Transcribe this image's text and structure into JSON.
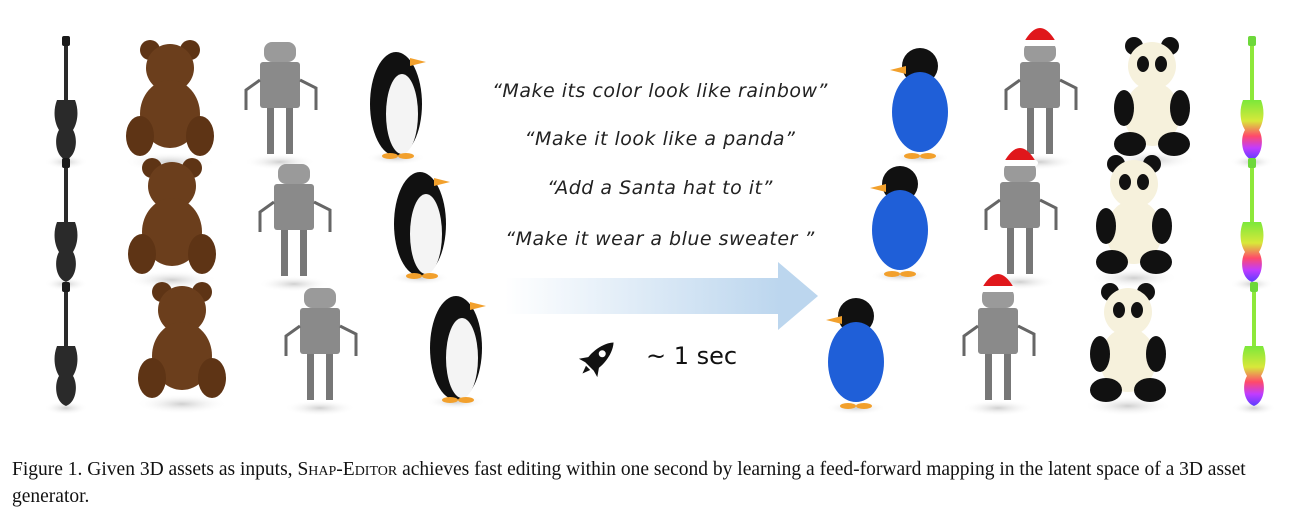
{
  "prompts": [
    "“Make its color look like rainbow”",
    "“Make it look like a panda”",
    "“Add a Santa hat to it”",
    "“Make it wear a blue sweater ”"
  ],
  "speed_label": "~ 1 sec",
  "caption": {
    "prefix": "Figure 1. Given 3D assets as inputs, ",
    "method": "Shap-Editor",
    "suffix": " achieves fast editing within one second by learning a feed-forward mapping in the latent space of a 3D asset generator."
  },
  "colors": {
    "guitar": "#2a2a2a",
    "bear": "#6b3e1c",
    "robot": "#8a8a8a",
    "penguin": "#111111",
    "sweater_blue": "#1f5fd8",
    "santa_red": "#e0171b",
    "arrow": "#c6dcf0"
  },
  "icons": [
    "guitar-icon",
    "teddy-bear-icon",
    "robot-icon",
    "penguin-icon",
    "rocket-icon",
    "arrow-right-icon"
  ]
}
